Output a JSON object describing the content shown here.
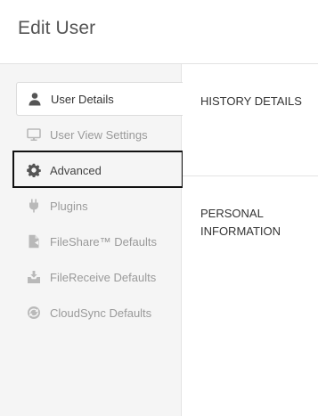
{
  "page": {
    "title": "Edit User"
  },
  "sidebar": {
    "items": [
      {
        "label": "User Details",
        "icon": "user-icon",
        "state": "active"
      },
      {
        "label": "User View Settings",
        "icon": "monitor-icon",
        "state": "normal"
      },
      {
        "label": "Advanced",
        "icon": "gear-icon",
        "state": "focused"
      },
      {
        "label": "Plugins",
        "icon": "plug-icon",
        "state": "normal"
      },
      {
        "label": "FileShare™ Defaults",
        "icon": "fileshare-icon",
        "state": "normal"
      },
      {
        "label": "FileReceive Defaults",
        "icon": "filereceive-icon",
        "state": "normal"
      },
      {
        "label": "CloudSync Defaults",
        "icon": "cloudsync-icon",
        "state": "normal"
      }
    ]
  },
  "main": {
    "sections": [
      {
        "title": "HISTORY DETAILS"
      },
      {
        "title": "PERSONAL INFORMATION"
      }
    ]
  },
  "colors": {
    "sidebar_bg": "#f5f5f5",
    "active_text": "#333333",
    "inactive_text": "#9a9a9a",
    "focus_ring": "#111111"
  }
}
